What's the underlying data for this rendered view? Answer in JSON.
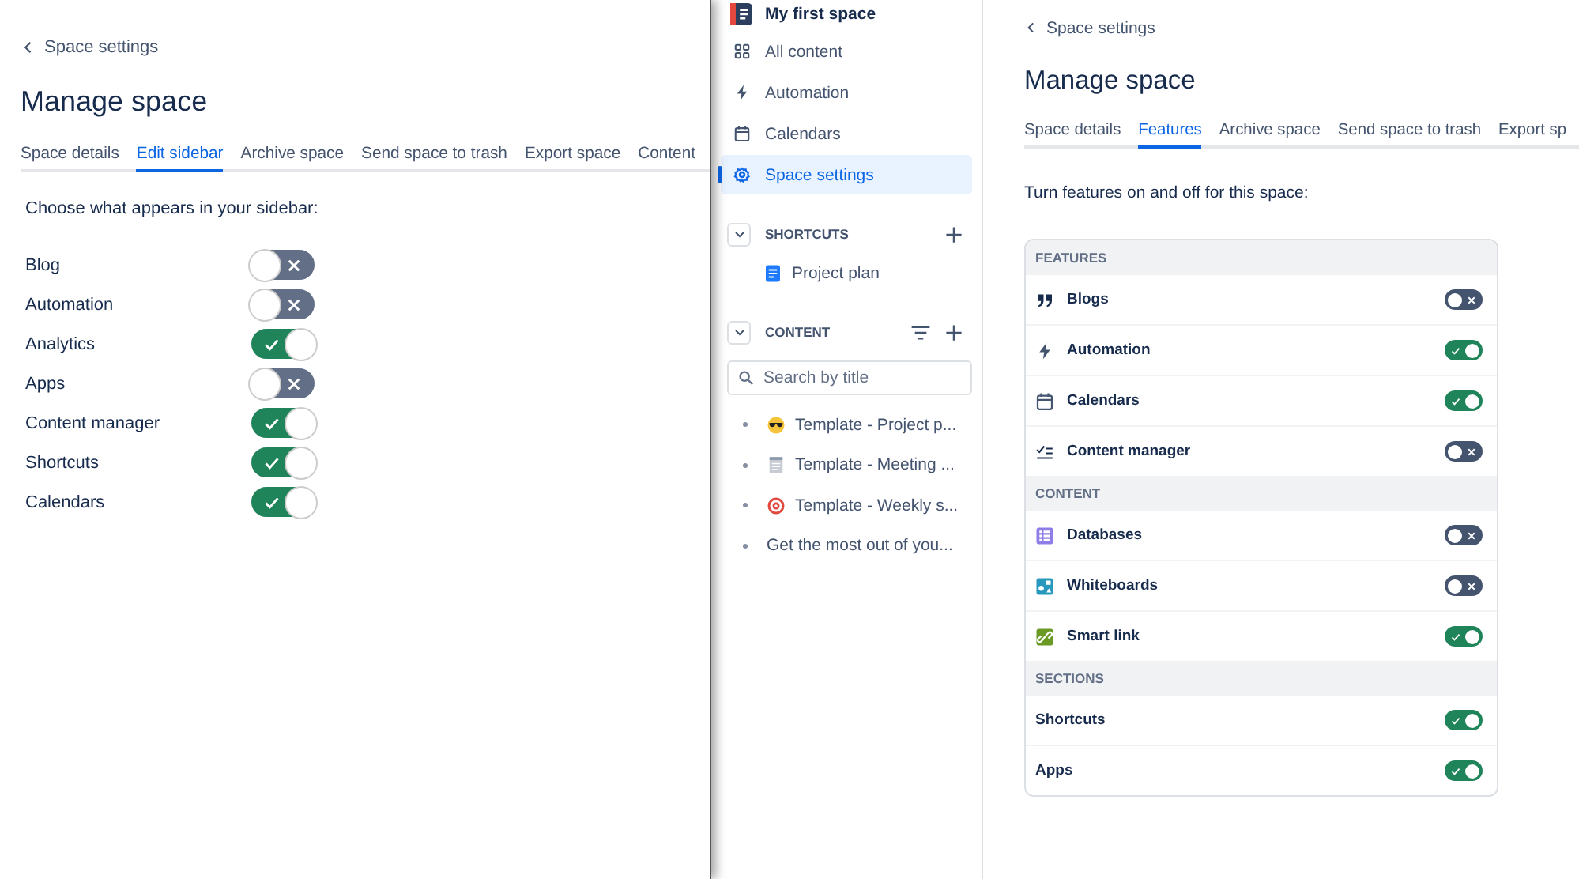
{
  "left_panel": {
    "back_link": "Space settings",
    "title": "Manage space",
    "tabs": [
      {
        "label": "Space details",
        "selected": false
      },
      {
        "label": "Edit sidebar",
        "selected": true
      },
      {
        "label": "Archive space",
        "selected": false
      },
      {
        "label": "Send space to trash",
        "selected": false
      },
      {
        "label": "Export space",
        "selected": false
      },
      {
        "label": "Content",
        "selected": false
      }
    ],
    "intro": "Choose what appears in your sidebar:",
    "toggles": [
      {
        "label": "Blog",
        "on": false
      },
      {
        "label": "Automation",
        "on": false
      },
      {
        "label": "Analytics",
        "on": true
      },
      {
        "label": "Apps",
        "on": false
      },
      {
        "label": "Content manager",
        "on": true
      },
      {
        "label": "Shortcuts",
        "on": true
      },
      {
        "label": "Calendars",
        "on": true
      }
    ]
  },
  "sidebar": {
    "space_name": "My first space",
    "nav": [
      {
        "label": "All content",
        "kind": "grid",
        "selected": false
      },
      {
        "label": "Automation",
        "kind": "bolt",
        "selected": false
      },
      {
        "label": "Calendars",
        "kind": "calendar",
        "selected": false
      },
      {
        "label": "Space settings",
        "kind": "gear",
        "selected": true
      }
    ],
    "shortcuts": {
      "heading": "SHORTCUTS",
      "items": [
        {
          "label": "Project plan",
          "kind": "doc"
        }
      ]
    },
    "content": {
      "heading": "CONTENT",
      "search": {
        "placeholder": "Search by title"
      },
      "pages": [
        {
          "label": "Template - Project p...",
          "kind": "sunglasses"
        },
        {
          "label": "Template - Meeting ...",
          "kind": "notepad"
        },
        {
          "label": "Template - Weekly s...",
          "kind": "target"
        },
        {
          "label": "Get the most out of you..."
        }
      ]
    }
  },
  "main": {
    "back_link": "Space settings",
    "title": "Manage space",
    "tabs": [
      {
        "label": "Space details",
        "selected": false
      },
      {
        "label": "Features",
        "selected": true
      },
      {
        "label": "Archive space",
        "selected": false
      },
      {
        "label": "Send space to trash",
        "selected": false
      },
      {
        "label": "Export sp",
        "selected": false
      }
    ],
    "intro": "Turn features on and off for this space:",
    "sections": [
      {
        "heading": "FEATURES",
        "items": [
          {
            "label": "Blogs",
            "kind": "quote",
            "on": false
          },
          {
            "label": "Automation",
            "kind": "bolt",
            "on": true
          },
          {
            "label": "Calendars",
            "kind": "calendar",
            "on": true
          },
          {
            "label": "Content manager",
            "kind": "checklist",
            "on": false
          }
        ]
      },
      {
        "heading": "CONTENT",
        "items": [
          {
            "label": "Databases",
            "kind": "database",
            "on": false
          },
          {
            "label": "Whiteboards",
            "kind": "whiteboard",
            "on": false
          },
          {
            "label": "Smart link",
            "kind": "smartlink",
            "on": true
          }
        ]
      },
      {
        "heading": "SECTIONS",
        "items": [
          {
            "label": "Shortcuts",
            "on": true
          },
          {
            "label": "Apps",
            "on": true
          }
        ]
      }
    ]
  }
}
